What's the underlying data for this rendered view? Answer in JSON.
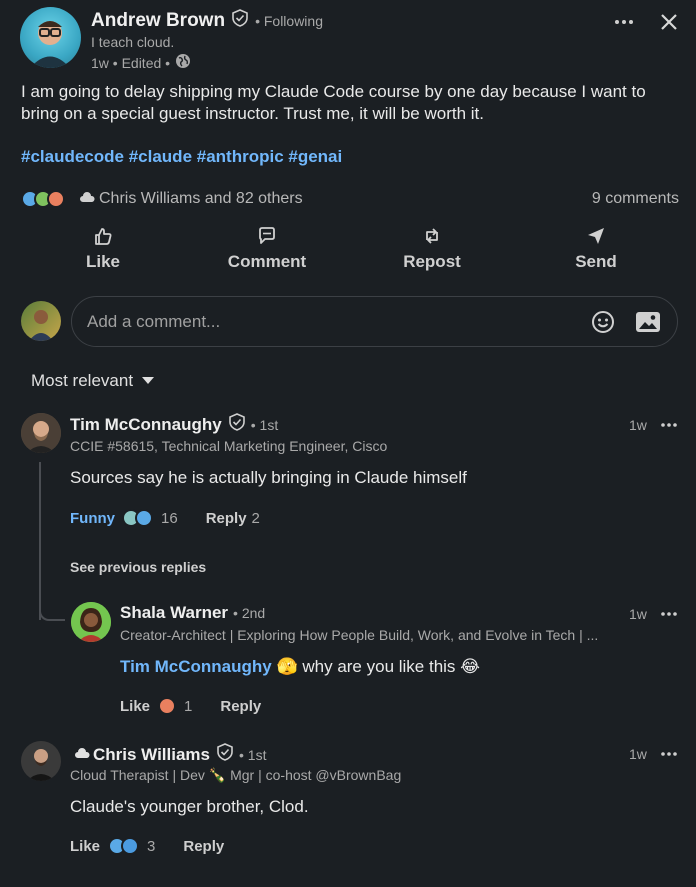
{
  "post": {
    "author_name": "Andrew Brown",
    "following": "• Following",
    "headline": "I teach cloud.",
    "meta": "1w • Edited •",
    "text": "I am going to delay shipping my Claude Code course by one day because I want to bring on a special guest instructor.  Trust me, it will be worth it.",
    "hashtags": "#claudecode #claude #anthropic #genai",
    "reactions_text": "Chris Williams and 82 others",
    "comments_count": "9 comments"
  },
  "actions": {
    "like": "Like",
    "comment": "Comment",
    "repost": "Repost",
    "send": "Send"
  },
  "composer": {
    "placeholder": "Add a comment..."
  },
  "sort": {
    "label": "Most relevant"
  },
  "comments": [
    {
      "name": "Tim McConnaughy",
      "degree": "• 1st",
      "headline": "CCIE #58615, Technical Marketing Engineer, Cisco",
      "time": "1w",
      "text": "Sources say he is actually bringing in Claude himself",
      "reaction_label": "Funny",
      "reaction_count": "16",
      "reply_label": "Reply",
      "reply_count": "2",
      "see_previous": "See previous replies"
    },
    {
      "name": "Shala Warner",
      "degree": "• 2nd",
      "headline": "Creator-Architect | Exploring How People Build, Work, and Evolve in Tech | ...",
      "time": "1w",
      "mention": "Tim McConnaughy",
      "text": " 🫣 why are you like this 😂",
      "like_label": "Like",
      "reaction_count": "1",
      "reply_label": "Reply"
    },
    {
      "name": "Chris Williams",
      "degree": "• 1st",
      "headline": "Cloud Therapist | Dev 🍾 Mgr | co-host @vBrownBag",
      "time": "1w",
      "text": "Claude's younger brother, Clod.",
      "like_label": "Like",
      "reaction_count": "3",
      "reply_label": "Reply"
    }
  ],
  "colors": {
    "background": "#1b1f23",
    "link": "#71b7fb",
    "muted": "#a9a9a9"
  }
}
